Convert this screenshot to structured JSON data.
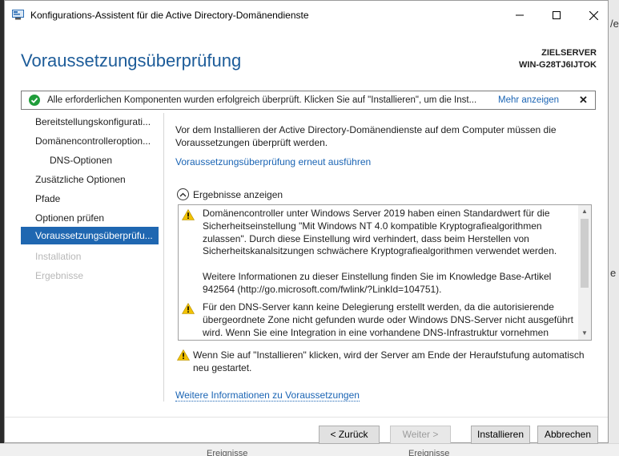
{
  "window": {
    "title": "Konfigurations-Assistent für die Active Directory-Domänendienste"
  },
  "header": {
    "page_title": "Voraussetzungsüberprüfung",
    "target_label": "ZIELSERVER",
    "target_server": "WIN-G28TJ6IJTOK"
  },
  "banner": {
    "message": "Alle erforderlichen Komponenten wurden erfolgreich überprüft. Klicken Sie auf \"Installieren\", um die Inst...",
    "more_link": "Mehr anzeigen",
    "close_glyph": "✕"
  },
  "nav": {
    "items": [
      {
        "label": "Bereitstellungskonfigurati...",
        "state": "normal"
      },
      {
        "label": "Domänencontrolleroption...",
        "state": "normal"
      },
      {
        "label": "DNS-Optionen",
        "state": "sub"
      },
      {
        "label": "Zusätzliche Optionen",
        "state": "normal"
      },
      {
        "label": "Pfade",
        "state": "normal"
      },
      {
        "label": "Optionen prüfen",
        "state": "normal"
      },
      {
        "label": "Voraussetzungsüberprüfu...",
        "state": "active"
      },
      {
        "label": "Installation",
        "state": "disabled"
      },
      {
        "label": "Ergebnisse",
        "state": "disabled"
      }
    ]
  },
  "content": {
    "intro": "Vor dem Installieren der Active Directory-Domänendienste auf dem Computer müssen die Voraussetzungen überprüft werden.",
    "rerun_link": "Voraussetzungsüberprüfung erneut ausführen",
    "results_toggle": "Ergebnisse anzeigen",
    "results": [
      {
        "p1": "Domänencontroller unter Windows Server 2019 haben einen Standardwert für die Sicherheitseinstellung \"Mit Windows NT 4.0 kompatible Kryptografiealgorithmen zulassen\". Durch diese Einstellung wird verhindert, dass beim Herstellen von Sicherheitskanalsitzungen schwächere Kryptografiealgorithmen verwendet werden.",
        "p2": "Weitere Informationen zu dieser Einstellung finden Sie im Knowledge Base-Artikel 942564 (http://go.microsoft.com/fwlink/?LinkId=104751)."
      },
      {
        "p1": "Für den DNS-Server kann keine Delegierung erstellt werden, da die autorisierende übergeordnete Zone nicht gefunden wurde oder Windows DNS-Server nicht ausgeführt wird. Wenn Sie eine Integration in eine vorhandene DNS-Infrastruktur vornehmen möchten, müssen Sie manuell eine Delegierung zu diesem DNS-Server in der"
      }
    ],
    "restart_warning": "Wenn Sie auf \"Installieren\" klicken, wird der Server am Ende der Heraufstufung automatisch neu gestartet.",
    "more_info_link": "Weitere Informationen zu Voraussetzungen"
  },
  "buttons": {
    "back": "< Zurück",
    "next": "Weiter >",
    "install": "Installieren",
    "cancel": "Abbrechen"
  },
  "background": {
    "right_chars": [
      "/e",
      "e"
    ],
    "bottom_fragments": [
      "Ereignisse",
      "Ereignisse"
    ]
  },
  "colors": {
    "accent": "#1f67b1",
    "title_blue": "#1d5c99",
    "link": "#1a64b4",
    "success": "#1f9d3a",
    "warning": "#f2c200"
  }
}
